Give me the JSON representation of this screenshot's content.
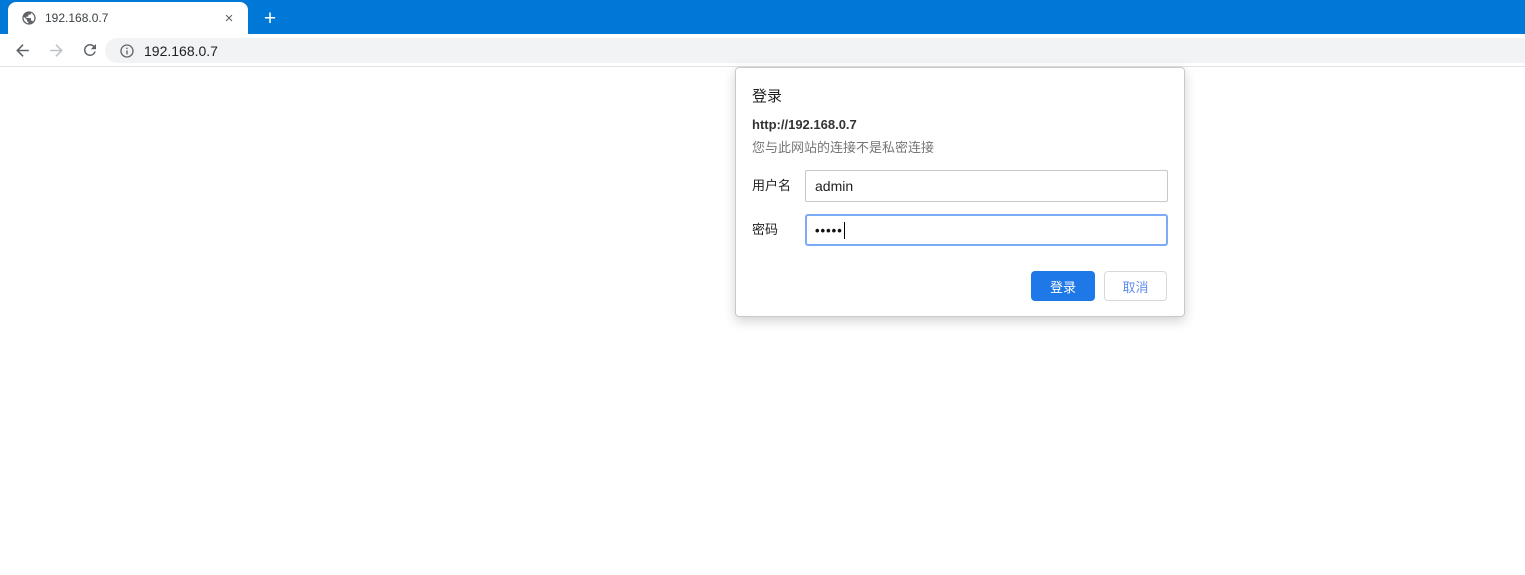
{
  "browser": {
    "tab": {
      "title": "192.168.0.7",
      "close_glyph": "×",
      "new_tab_glyph": "+"
    },
    "omnibox": {
      "url": "192.168.0.7"
    },
    "colors": {
      "tabstrip_blue": "#0078d7",
      "icon_gray": "#5f6368",
      "icon_disabled_gray": "#c0c3c7",
      "omnibox_gray": "#f1f3f4"
    }
  },
  "auth_dialog": {
    "title": "登录",
    "origin": "http://192.168.0.7",
    "warning": "您与此网站的连接不是私密连接",
    "fields": {
      "username_label": "用户名",
      "username_value": "admin",
      "password_label": "密码",
      "password_masked": "•••••"
    },
    "buttons": {
      "signin_label": "登录",
      "cancel_label": "取消"
    },
    "colors": {
      "signin_blue": "#1f78e8",
      "focus_border": "#7baaf7"
    }
  }
}
